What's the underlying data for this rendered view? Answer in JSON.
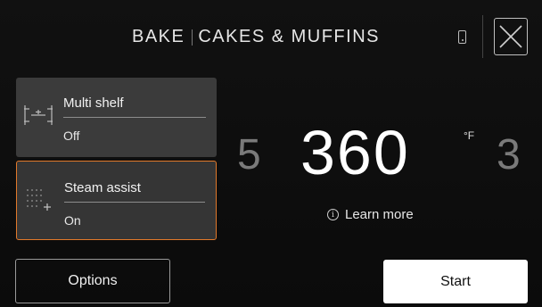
{
  "header": {
    "mode": "BAKE",
    "program": "CAKES & MUFFINS",
    "phone_icon": "phone-icon",
    "close_icon": "close-icon"
  },
  "cards": [
    {
      "label": "Multi shelf",
      "value": "Off",
      "icon": "multi-shelf-icon"
    },
    {
      "label": "Steam assist",
      "value": "On",
      "icon": "steam-assist-icon",
      "selected": true,
      "accent": "#e2792a"
    }
  ],
  "temperature": {
    "previous": "5",
    "value": "360",
    "unit": "°F",
    "next": "3"
  },
  "learn_more": {
    "label": "Learn more",
    "icon": "info-icon"
  },
  "buttons": {
    "options": "Options",
    "start": "Start"
  }
}
